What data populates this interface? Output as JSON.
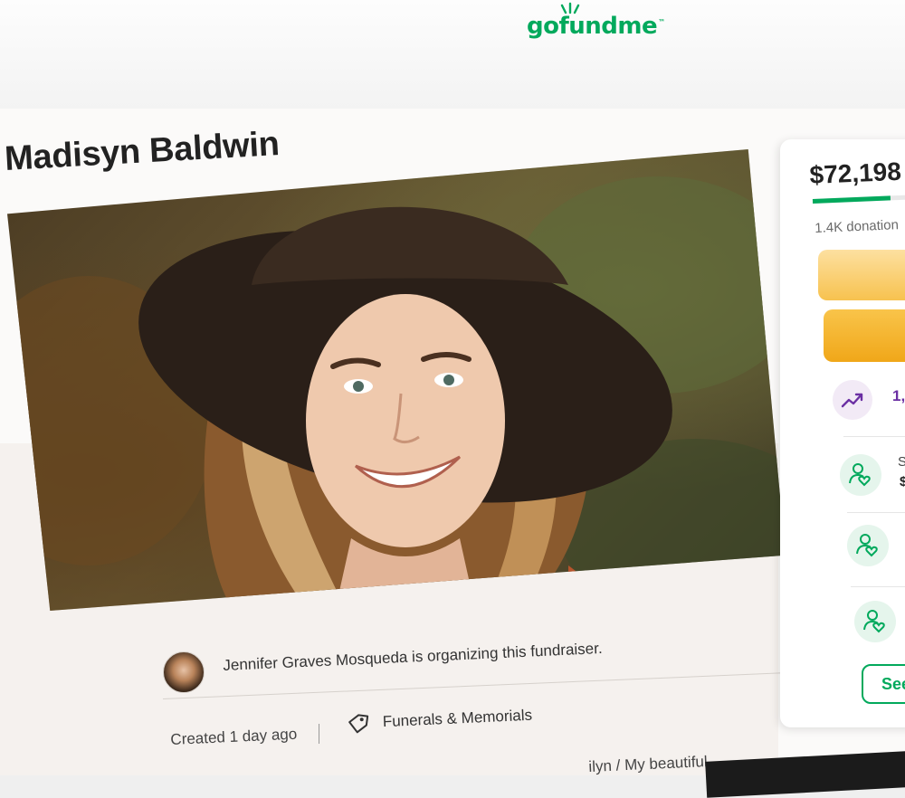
{
  "header": {
    "logo_text": "gofundme",
    "logo_tm": "™",
    "brand_color": "#02a95c"
  },
  "campaign": {
    "title": "Madisyn Baldwin",
    "organizer_text": "Jennifer Graves Mosqueda is organizing this fundraiser.",
    "created": "Created 1 day ago",
    "category": "Funerals & Memorials",
    "category_icon": "tag-icon",
    "story_teaser": "ilyn / My beautiful"
  },
  "donation_card": {
    "amount_raised": "$72,198",
    "progress_fraction": 0.72,
    "donations_count": "1.4K donation",
    "share_button_label": "",
    "donate_button_label": "",
    "trend_icon": "trending-up-icon",
    "trend_count": "1,",
    "rows": [
      {
        "icon": "donor-heart-icon",
        "line1": "S",
        "line2": "$"
      },
      {
        "icon": "donor-heart-icon",
        "line1": "",
        "line2": ""
      },
      {
        "icon": "donor-heart-icon",
        "line1": "",
        "line2": ""
      }
    ],
    "see_button_label": "See"
  }
}
